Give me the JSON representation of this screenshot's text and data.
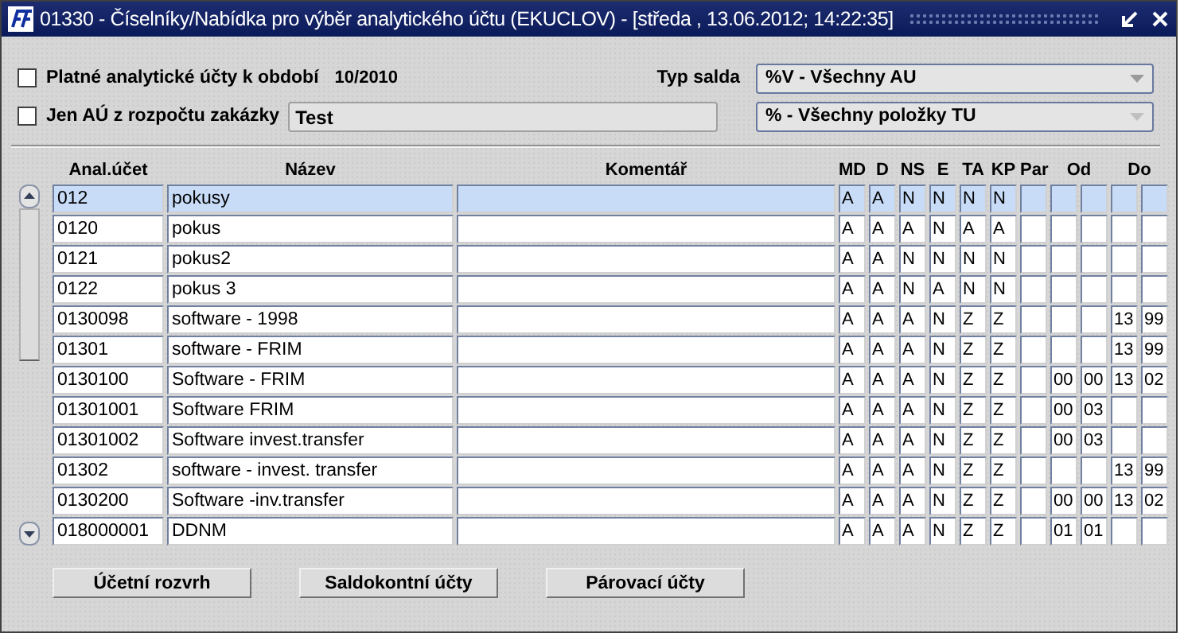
{
  "window": {
    "title": "01330 - Číselníky/Nabídka pro výběr analytického účtu (EKUCLOV) - [středa , 13.06.2012; 14:22:35]"
  },
  "filters": {
    "period": {
      "label": "Platné analytické účty k období",
      "checked": false,
      "value": "10/2010"
    },
    "contract": {
      "label": "Jen AÚ z rozpočtu zakázky",
      "checked": false,
      "value": "Test"
    },
    "balance_type": {
      "label": "Typ salda",
      "value": "%V - Všechny AU"
    },
    "item_type": {
      "value": "% - Všechny položky TU"
    }
  },
  "table": {
    "columns": [
      "Anal.účet",
      "Název",
      "Komentář",
      "MD",
      "D",
      "NS",
      "E",
      "TA",
      "KP",
      "Par",
      "Od",
      "Do"
    ],
    "rows": [
      {
        "account": "012",
        "name": "pokusy",
        "codes": [
          "A",
          "A",
          "N",
          "N",
          "N",
          "N"
        ],
        "selected": true
      },
      {
        "account": "0120",
        "name": "pokus",
        "codes": [
          "A",
          "A",
          "A",
          "N",
          "A",
          "A"
        ],
        "selected": false
      },
      {
        "account": "0121",
        "name": "pokus2",
        "codes": [
          "A",
          "A",
          "N",
          "N",
          "N",
          "N"
        ],
        "selected": false
      },
      {
        "account": "0122",
        "name": "pokus 3",
        "codes": [
          "A",
          "A",
          "N",
          "A",
          "N",
          "N"
        ],
        "selected": false
      },
      {
        "account": "0130098",
        "name": "software - 1998",
        "codes": [
          "A",
          "A",
          "A",
          "N",
          "Z",
          "Z"
        ],
        "do": [
          "13",
          "99"
        ],
        "selected": false
      },
      {
        "account": "01301",
        "name": "software - FRIM",
        "codes": [
          "A",
          "A",
          "A",
          "N",
          "Z",
          "Z"
        ],
        "do": [
          "13",
          "99"
        ],
        "selected": false
      },
      {
        "account": "0130100",
        "name": "Software - FRIM",
        "codes": [
          "A",
          "A",
          "A",
          "N",
          "Z",
          "Z"
        ],
        "od": [
          "00",
          "00"
        ],
        "do": [
          "13",
          "02"
        ],
        "selected": false
      },
      {
        "account": "01301001",
        "name": "Software FRIM",
        "codes": [
          "A",
          "A",
          "A",
          "N",
          "Z",
          "Z"
        ],
        "od": [
          "00",
          "03"
        ],
        "selected": false
      },
      {
        "account": "01301002",
        "name": "Software invest.transfer",
        "codes": [
          "A",
          "A",
          "A",
          "N",
          "Z",
          "Z"
        ],
        "od": [
          "00",
          "03"
        ],
        "selected": false
      },
      {
        "account": "01302",
        "name": "software - invest. transfer",
        "codes": [
          "A",
          "A",
          "A",
          "N",
          "Z",
          "Z"
        ],
        "do": [
          "13",
          "99"
        ],
        "selected": false
      },
      {
        "account": "0130200",
        "name": "Software -inv.transfer",
        "codes": [
          "A",
          "A",
          "A",
          "N",
          "Z",
          "Z"
        ],
        "od": [
          "00",
          "00"
        ],
        "do": [
          "13",
          "02"
        ],
        "selected": false
      },
      {
        "account": "018000001",
        "name": "DDNM",
        "codes": [
          "A",
          "A",
          "A",
          "N",
          "Z",
          "Z"
        ],
        "od": [
          "01",
          "01"
        ],
        "selected": false
      }
    ]
  },
  "buttons": [
    "Účetní rozvrh",
    "Saldokontní účty",
    "Párovací účty"
  ]
}
